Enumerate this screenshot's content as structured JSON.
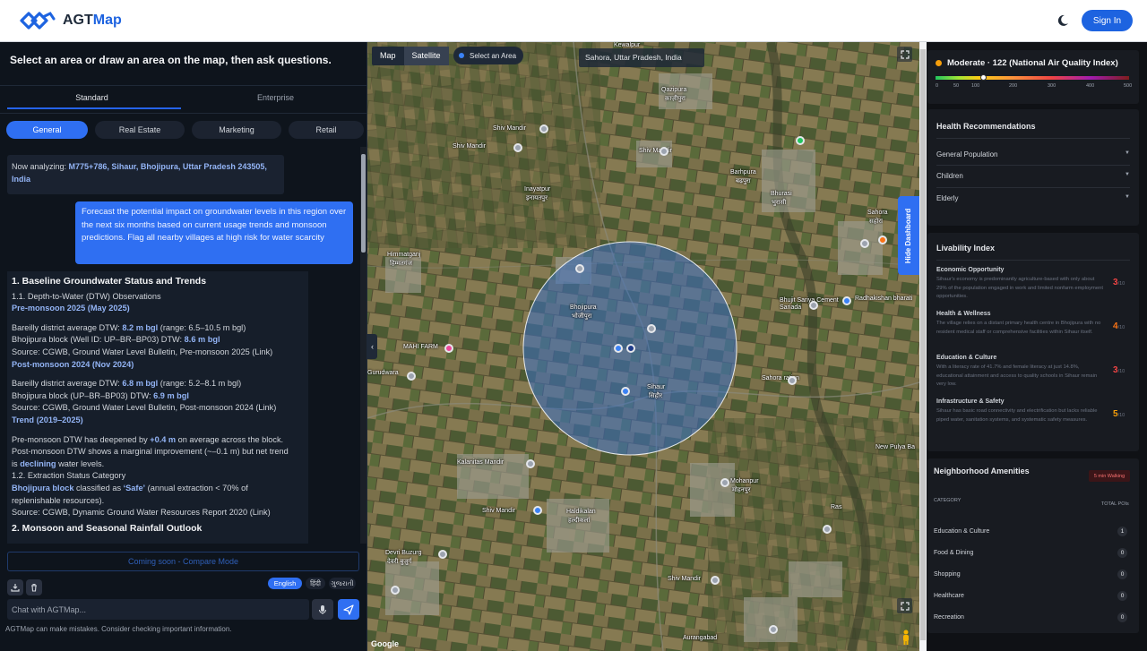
{
  "header": {
    "brand_a": "AGT",
    "brand_b": "Map",
    "signin_label": "Sign In"
  },
  "left": {
    "title": "Select an area or draw an area on the map, then ask questions.",
    "mode_tabs": [
      "Standard",
      "Enterprise"
    ],
    "category_tabs": [
      "General",
      "Real Estate",
      "Marketing",
      "Retail"
    ],
    "analyzing_prefix": "Now analyzing: ",
    "analyzing_location": "M775+786, Sihaur, Bhojipura, Uttar Pradesh 243505, India",
    "user_message": "Forecast the potential impact on groundwater levels in this region over the next six months based on current usage trends and monsoon predictions. Flag all nearby villages at high risk for water scarcity",
    "answer": {
      "h1": "1. Baseline Groundwater Status and Trends",
      "sub1": "1.1. Depth-to-Water (DTW) Observations",
      "pre2025": "Pre-monsoon 2025 (May 2025)",
      "l1a": "Bareilly district average DTW: ",
      "l1b": "8.2 m bgl",
      "l1c": " (range: 6.5–10.5 m bgl)",
      "l2a": "Bhojipura block (Well ID: UP–BR–BP03) DTW: ",
      "l2b": "8.6 m bgl",
      "l3": "Source: CGWB, Ground Water Level Bulletin, Pre-monsoon 2025 (Link)",
      "post2024": "Post-monsoon 2024 (Nov 2024)",
      "l4a": "Bareilly district average DTW: ",
      "l4b": "6.8 m bgl",
      "l4c": " (range: 5.2–8.1 m bgl)",
      "l5a": "Bhojipura block (UP–BR–BP03) DTW: ",
      "l5b": "6.9 m bgl",
      "l6": "Source: CGWB, Ground Water Level Bulletin, Post-monsoon 2024 (Link)",
      "trend": "Trend (2019–2025)",
      "l7a": "Pre-monsoon DTW has deepened by ",
      "l7b": "+0.4 m",
      "l7c": " on average across the block.",
      "l8": "Post-monsoon DTW shows a marginal improvement (~–0.1 m) but net trend",
      "l9a": "is ",
      "l9b": "declining",
      "l9c": " water levels.",
      "sub2": "1.2. Extraction Status Category",
      "l10a": "Bhojipura block",
      "l10b": " classified as ",
      "l10c": "‘Safe’",
      "l10d": " (annual extraction < 70% of",
      "l11": "replenishable resources).",
      "l12": "Source: CGWB, Dynamic Ground Water Resources Report 2020 (Link)",
      "h2": "2. Monsoon and Seasonal Rainfall Outlook"
    },
    "compare_label": "Coming soon - Compare Mode",
    "languages": [
      "English",
      "हिंदी",
      "ગુજરાતી"
    ],
    "input_placeholder": "Chat with AGTMap...",
    "disclaimer": "AGTMap can make mistakes. Consider checking important information."
  },
  "map": {
    "type_options": [
      "Map",
      "Satellite"
    ],
    "select_area_label": "Select an Area",
    "location": "Sahora, Uttar Pradesh, India",
    "hide_dashboard_label": "Hide Dashboard",
    "attribution": "Google",
    "labels": {
      "kewalpur": "Kewalpur",
      "qaziapura": "Qazipura",
      "qaziapura_hi": "क़ाज़ीपुरा",
      "shiv_mandir1": "Shiv Mandir",
      "shiv_mandir2": "Shiv Mandir",
      "shiv_mandir3": "Shiv Mandir",
      "inayatpur": "Inayatpur",
      "inayatpur_hi": "इनायतपुर",
      "barhpura": "Barhpura",
      "barhpura_hi": "बढ़पुरा",
      "bhurasi": "Bhurasi",
      "bhurasi_hi": "भुरासी",
      "sahora": "Sahora",
      "sahora_hi": "सहोरा",
      "himmatganj": "Himmatganj",
      "himmatganj_hi": "हिम्मतगंज",
      "bhojipura": "Bhojipura",
      "bhojipura_hi": "भोजीपुरा",
      "sihaur": "Sihaur",
      "sihaur_hi": "सिहौर",
      "bhujit": "Bhujit Sariya Cement Sariada",
      "radhakishan": "Radhakishan bharati",
      "mahi_farm": "MAHI FARM",
      "gurudwara": "Gurudwara",
      "sahora_ration": "Sahora ration",
      "new_pulya": "New Pulya Ba",
      "kalanitas": "Kalanitas Mandir",
      "shiv_mandir4": "Shiv Mandir",
      "haldikalan": "Haldikalan",
      "haldikalan_hi": "हल्दीकलां",
      "mohanpur": "Mohanpur",
      "mohanpur_hi": "मोहनपुर",
      "ras": "Ras",
      "devri": "Devri Buzurg",
      "devri_hi": "देवरी बुजुर्ग",
      "shiv_mandir5": "Shiv Mandir",
      "aurangabad": "Aurangabad"
    }
  },
  "aqi": {
    "title": "Moderate · 122 (National Air Quality Index)",
    "value": 122,
    "max": 500,
    "ticks": [
      "0",
      "50",
      "100",
      "200",
      "300",
      "400",
      "500"
    ]
  },
  "health": {
    "title": "Health Recommendations",
    "items": [
      "General Population",
      "Children",
      "Elderly"
    ]
  },
  "livability": {
    "title": "Livability Index",
    "items": [
      {
        "name": "Economic Opportunity",
        "desc": "Sihaur's economy is predominantly agriculture-based with only about 29% of the population engaged in work and limited nonfarm employment opportunities.",
        "score": "3",
        "out_of": "/10",
        "color": "#ef4444"
      },
      {
        "name": "Health & Wellness",
        "desc": "The village relies on a distant primary health centre in Bhojipura with no resident medical staff or comprehensive facilities within Sihaur itself.",
        "score": "4",
        "out_of": "/10",
        "color": "#f97316"
      },
      {
        "name": "Education & Culture",
        "desc": "With a literacy rate of 41.7% and female literacy at just 14.8%, educational attainment and access to quality schools in Sihaur remain very low.",
        "score": "3",
        "out_of": "/10",
        "color": "#ef4444"
      },
      {
        "name": "Infrastructure & Safety",
        "desc": "Sihaur has basic road connectivity and electrification but lacks reliable piped water, sanitation systems, and systematic safety measures.",
        "score": "5",
        "out_of": "/10",
        "color": "#f59e0b"
      }
    ]
  },
  "amenities": {
    "title": "Neighborhood Amenities",
    "badge": "5 min Walking",
    "col_category": "CATEGORY",
    "col_total": "TOTAL POIs",
    "rows": [
      {
        "label": "Education & Culture",
        "count": "1"
      },
      {
        "label": "Food & Dining",
        "count": "0"
      },
      {
        "label": "Shopping",
        "count": "0"
      },
      {
        "label": "Healthcare",
        "count": "0"
      },
      {
        "label": "Recreation",
        "count": "0"
      }
    ]
  },
  "colors": {
    "accent": "#2f6ff2",
    "circle_fill": "#3b6fc4"
  }
}
